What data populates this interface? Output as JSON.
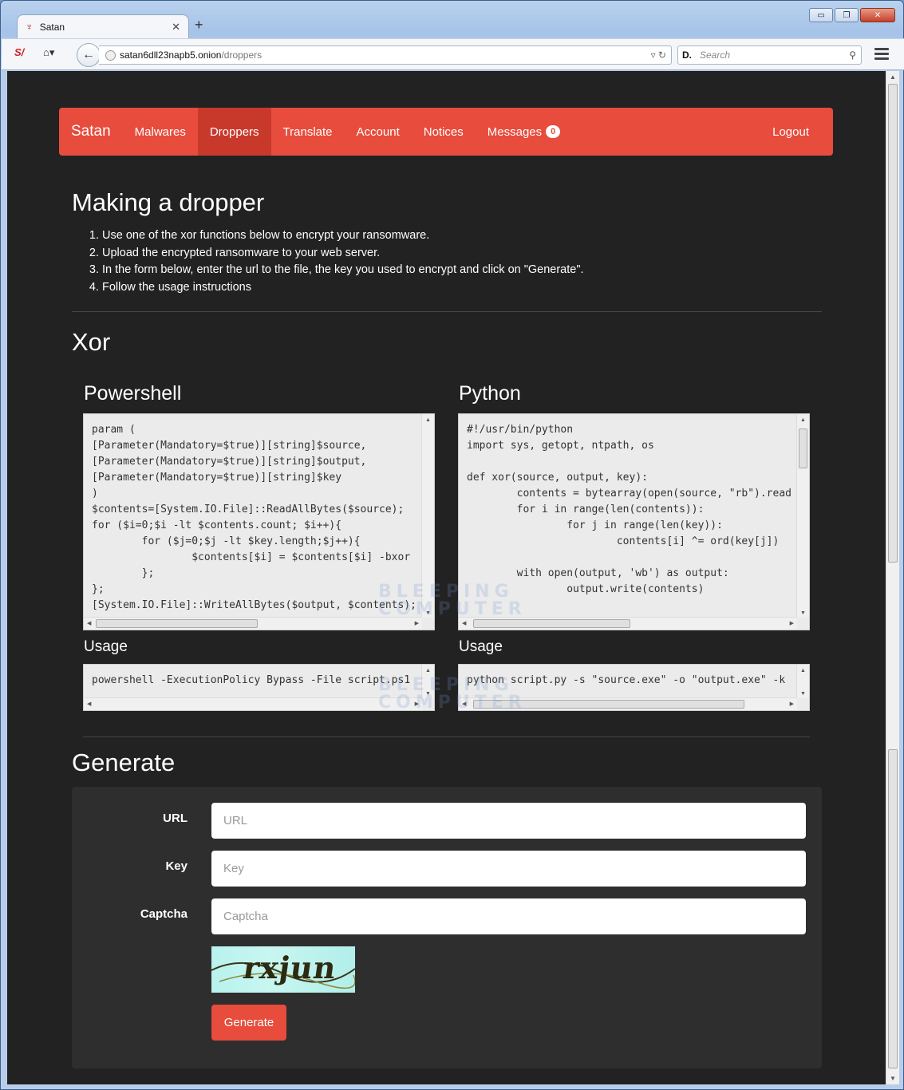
{
  "browser": {
    "tab_title": "Satan",
    "new_tab_glyph": "+",
    "url_host": "satan6dll23napb5.onion",
    "url_path": "/droppers",
    "search_placeholder": "Search",
    "search_engine": "D.",
    "win_minimize": "▭",
    "win_restore": "❐",
    "win_close": "✕"
  },
  "navbar": {
    "brand": "Satan",
    "items": [
      {
        "label": "Malwares"
      },
      {
        "label": "Droppers"
      },
      {
        "label": "Translate"
      },
      {
        "label": "Account"
      },
      {
        "label": "Notices"
      },
      {
        "label": "Messages"
      }
    ],
    "messages_badge": "0",
    "logout": "Logout",
    "active_color": "#c9392b",
    "brand_color": "#e74c3c"
  },
  "intro": {
    "title": "Making a dropper",
    "steps": [
      "Use one of the xor functions below to encrypt your ransomware.",
      "Upload the encrypted ransomware to your web server.",
      "In the form below, enter the url to the file, the key you used to encrypt and click on \"Generate\".",
      "Follow the usage instructions"
    ]
  },
  "xor": {
    "title": "Xor",
    "powershell": {
      "title": "Powershell",
      "code": "param (\n[Parameter(Mandatory=$true)][string]$source,\n[Parameter(Mandatory=$true)][string]$output,\n[Parameter(Mandatory=$true)][string]$key\n)\n$contents=[System.IO.File]::ReadAllBytes($source);\nfor ($i=0;$i -lt $contents.count; $i++){\n        for ($j=0;$j -lt $key.length;$j++){\n                $contents[$i] = $contents[$i] -bxor\n        };\n};\n[System.IO.File]::WriteAllBytes($output, $contents);",
      "usage_title": "Usage",
      "usage": "powershell -ExecutionPolicy Bypass -File script.ps1"
    },
    "python": {
      "title": "Python",
      "code": "#!/usr/bin/python\nimport sys, getopt, ntpath, os\n\ndef xor(source, output, key):\n        contents = bytearray(open(source, \"rb\").read\n        for i in range(len(contents)):\n                for j in range(len(key)):\n                        contents[i] ^= ord(key[j])\n\n        with open(output, 'wb') as output:\n                output.write(contents)",
      "usage_title": "Usage",
      "usage": "python script.py -s \"source.exe\" -o \"output.exe\" -k"
    }
  },
  "generate": {
    "title": "Generate",
    "url_label": "URL",
    "url_placeholder": "URL",
    "key_label": "Key",
    "key_placeholder": "Key",
    "captcha_label": "Captcha",
    "captcha_placeholder": "Captcha",
    "captcha_text": "rxjun",
    "button": "Generate"
  },
  "watermark": {
    "line1": "BLEEPING",
    "line2": "COMPUTER"
  }
}
